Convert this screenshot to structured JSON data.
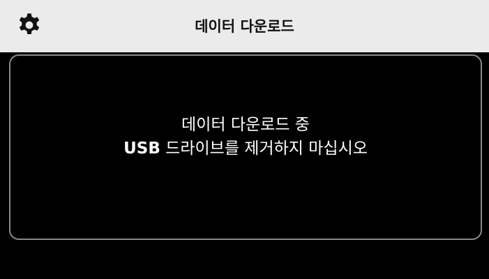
{
  "header": {
    "title": "데이터 다운로드",
    "settings_icon": "gear-icon"
  },
  "message": {
    "line1": "데이터 다운로드 중",
    "line2_bold": "USB",
    "line2_rest": " 드라이브를 제거하지 마십시오"
  },
  "colors": {
    "header_bg": "#ebebeb",
    "screen_bg": "#000000",
    "panel_border": "#8a8a8a",
    "text_light": "#ffffff",
    "text_dark": "#111111"
  }
}
